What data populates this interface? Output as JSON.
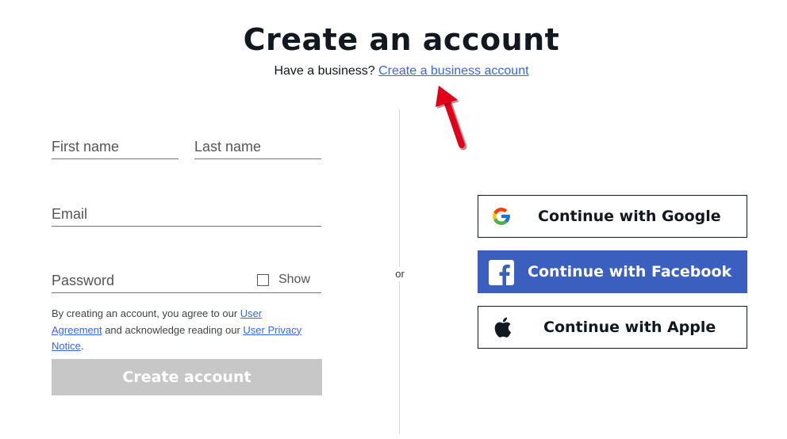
{
  "header": {
    "title": "Create an account",
    "business_prompt": "Have a business?",
    "business_link": "Create a business account"
  },
  "form": {
    "first_name_placeholder": "First name",
    "last_name_placeholder": "Last name",
    "email_placeholder": "Email",
    "password_placeholder": "Password",
    "show_label": "Show",
    "terms": {
      "text_1": "By creating an account, you agree to our ",
      "link_1": "User Agreement",
      "text_2": " and acknowledge reading our ",
      "link_2": "User Privacy Notice",
      "text_3": "."
    },
    "create_button": "Create account"
  },
  "divider_label": "or",
  "social": {
    "google": "Continue with Google",
    "facebook": "Continue with Facebook",
    "apple": "Continue with Apple"
  },
  "colors": {
    "link": "#3665f3",
    "facebook_bg": "#3b5fbf",
    "create_button_disabled": "#c7c7c7",
    "annotation_arrow": "#e0001a"
  },
  "icons": [
    "google-icon",
    "facebook-icon",
    "apple-icon",
    "annotation-arrow"
  ]
}
